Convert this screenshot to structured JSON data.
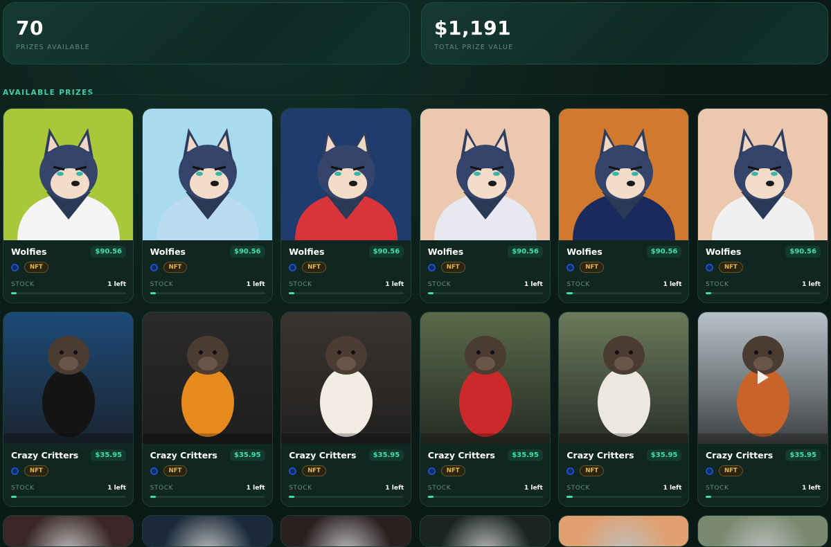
{
  "stats": [
    {
      "value": "70",
      "label": "PRIZES AVAILABLE"
    },
    {
      "value": "$1,191",
      "label": "TOTAL PRIZE VALUE"
    }
  ],
  "section_title": "AVAILABLE PRIZES",
  "prizes_row1": [
    {
      "name": "Wolfies",
      "price": "$90.56",
      "badge": "NFT",
      "stock_label": "STOCK",
      "stock": "1 left",
      "stock_level": 0.05,
      "bg": "#a8c83a",
      "shirt": "#f4f4f4"
    },
    {
      "name": "Wolfies",
      "price": "$90.56",
      "badge": "NFT",
      "stock_label": "STOCK",
      "stock": "1 left",
      "stock_level": 0.05,
      "bg": "#a9dbf0",
      "shirt": "#b9dcf2"
    },
    {
      "name": "Wolfies",
      "price": "$90.56",
      "badge": "NFT",
      "stock_label": "STOCK",
      "stock": "1 left",
      "stock_level": 0.05,
      "bg": "#1e3d6e",
      "shirt": "#d8343a"
    },
    {
      "name": "Wolfies",
      "price": "$90.56",
      "badge": "NFT",
      "stock_label": "STOCK",
      "stock": "1 left",
      "stock_level": 0.05,
      "bg": "#ecc8ae",
      "shirt": "#e8e8f0"
    },
    {
      "name": "Wolfies",
      "price": "$90.56",
      "badge": "NFT",
      "stock_label": "STOCK",
      "stock": "1 left",
      "stock_level": 0.05,
      "bg": "#d1792f",
      "shirt": "#1b2a5c"
    },
    {
      "name": "Wolfies",
      "price": "$90.56",
      "badge": "NFT",
      "stock_label": "STOCK",
      "stock": "1 left",
      "stock_level": 0.05,
      "bg": "#ecc8ae",
      "shirt": "#f0f0f0"
    }
  ],
  "prizes_row2": [
    {
      "name": "Crazy Critters",
      "price": "$35.95",
      "badge": "NFT",
      "stock_label": "STOCK",
      "stock": "1 left",
      "stock_level": 0.05,
      "bg": "#1d4a78",
      "outfit": "#141414"
    },
    {
      "name": "Crazy Critters",
      "price": "$35.95",
      "badge": "NFT",
      "stock_label": "STOCK",
      "stock": "1 left",
      "stock_level": 0.05,
      "bg": "#2a2a2a",
      "outfit": "#e68a1e"
    },
    {
      "name": "Crazy Critters",
      "price": "$35.95",
      "badge": "NFT",
      "stock_label": "STOCK",
      "stock": "1 left",
      "stock_level": 0.05,
      "bg": "#3a3430",
      "outfit": "#f2ece2"
    },
    {
      "name": "Crazy Critters",
      "price": "$35.95",
      "badge": "NFT",
      "stock_label": "STOCK",
      "stock": "1 left",
      "stock_level": 0.05,
      "bg": "#5a6a4a",
      "outfit": "#cc2a2a"
    },
    {
      "name": "Crazy Critters",
      "price": "$35.95",
      "badge": "NFT",
      "stock_label": "STOCK",
      "stock": "1 left",
      "stock_level": 0.05,
      "bg": "#6a7a5a",
      "outfit": "#ece8e0"
    },
    {
      "name": "Crazy Critters",
      "price": "$35.95",
      "badge": "NFT",
      "stock_label": "STOCK",
      "stock": "1 left",
      "stock_level": 0.05,
      "bg": "#b7c2c8",
      "outfit": "#c8642a"
    }
  ],
  "row3_colors": [
    "#3a2626",
    "#1a2a3a",
    "#2a2020",
    "#1a2420",
    "#e0a070",
    "#7a8a70"
  ]
}
